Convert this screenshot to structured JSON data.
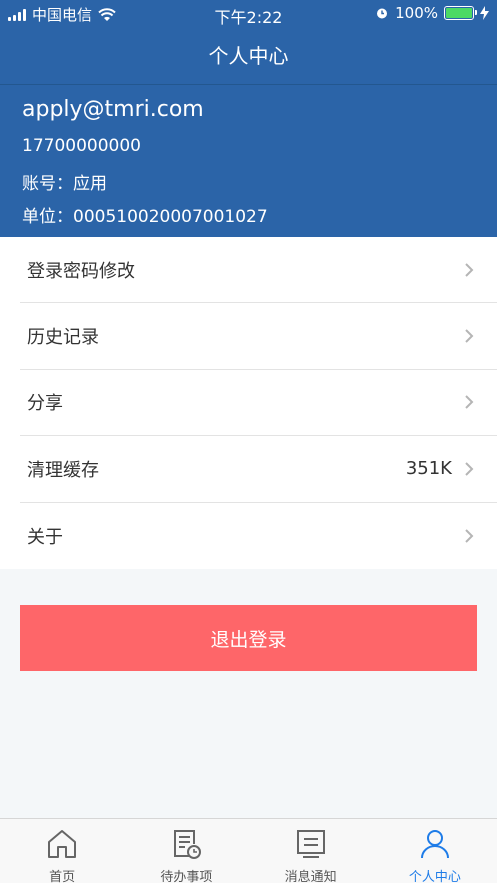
{
  "status_bar": {
    "carrier": "中国电信",
    "time": "下午2:22",
    "battery": "100%"
  },
  "nav": {
    "title": "个人中心"
  },
  "profile": {
    "email": "apply@tmri.com",
    "phone": "17700000000",
    "account": "账号：应用",
    "unit": "单位：000510020007001027"
  },
  "menu": {
    "items": [
      {
        "label": "登录密码修改",
        "value": ""
      },
      {
        "label": "历史记录",
        "value": ""
      },
      {
        "label": "分享",
        "value": ""
      },
      {
        "label": "清理缓存",
        "value": "351K"
      },
      {
        "label": "关于",
        "value": ""
      }
    ]
  },
  "logout": {
    "label": "退出登录"
  },
  "tabs": [
    {
      "label": "首页",
      "icon": "home-icon"
    },
    {
      "label": "待办事项",
      "icon": "todo-icon"
    },
    {
      "label": "消息通知",
      "icon": "message-icon"
    },
    {
      "label": "个人中心",
      "icon": "person-icon"
    }
  ],
  "colors": {
    "header_blue": "#2b64a8",
    "logout_red": "#fe6669",
    "active_tab": "#1e7ce8",
    "battery_green": "#4cd964"
  }
}
